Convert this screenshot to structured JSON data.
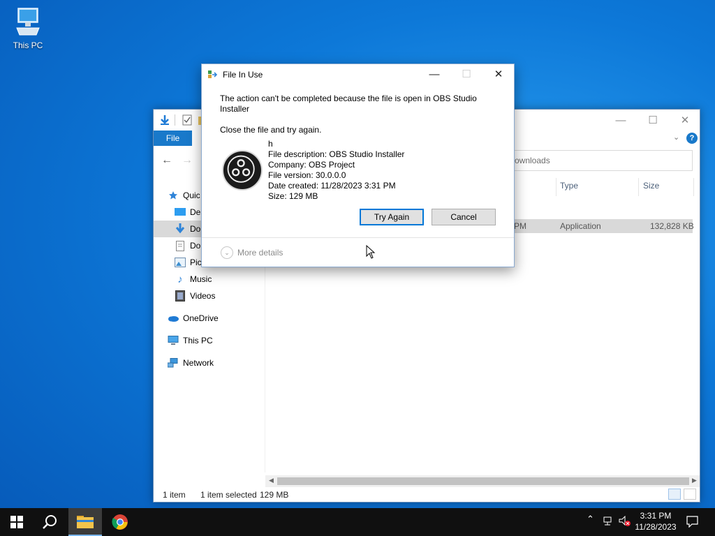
{
  "desktop": {
    "icons": [
      {
        "label": "This PC",
        "icon": "this-pc-icon"
      }
    ]
  },
  "explorer": {
    "ribbon": {
      "file_tab": "File"
    },
    "search_placeholder": "ownloads",
    "sidebar": {
      "items": [
        {
          "label": "Quic",
          "icon": "star-icon"
        },
        {
          "label": "Des",
          "icon": "desktop-folder-icon"
        },
        {
          "label": "Do",
          "icon": "downloads-icon"
        },
        {
          "label": "Do",
          "icon": "documents-icon"
        },
        {
          "label": "Pic",
          "icon": "pictures-icon"
        },
        {
          "label": "Music",
          "icon": "music-icon"
        },
        {
          "label": "Videos",
          "icon": "videos-icon"
        },
        {
          "label": "OneDrive",
          "icon": "onedrive-icon"
        },
        {
          "label": "This PC",
          "icon": "this-pc-icon"
        },
        {
          "label": "Network",
          "icon": "network-icon"
        }
      ]
    },
    "columns": {
      "type": "Type",
      "size": "Size"
    },
    "row": {
      "modified_fragment": "PM",
      "type": "Application",
      "size": "132,828 KB"
    },
    "status": {
      "count": "1 item",
      "selected": "1 item selected",
      "size": "129 MB"
    }
  },
  "dialog": {
    "title": "File In Use",
    "message_line1": "The action can't be completed because the file is open in OBS Studio",
    "message_line2": "Installer",
    "instruction": "Close the file and try again.",
    "file_name": "h",
    "file_description": "File description: OBS Studio Installer",
    "company": "Company: OBS Project",
    "file_version": "File version: 30.0.0.0",
    "date_created": "Date created: 11/28/2023 3:31 PM",
    "size": "Size: 129 MB",
    "try_again_label": "Try Again",
    "cancel_label": "Cancel",
    "more_details_label": "More details"
  },
  "taskbar": {
    "apps": [
      "start-icon",
      "search-icon",
      "file-explorer-icon",
      "chrome-icon"
    ],
    "time": "3:31 PM",
    "date": "11/28/2023"
  },
  "colors": {
    "accent": "#1979ca",
    "desktop": "#0d78d8",
    "taskbar": "#101010"
  }
}
